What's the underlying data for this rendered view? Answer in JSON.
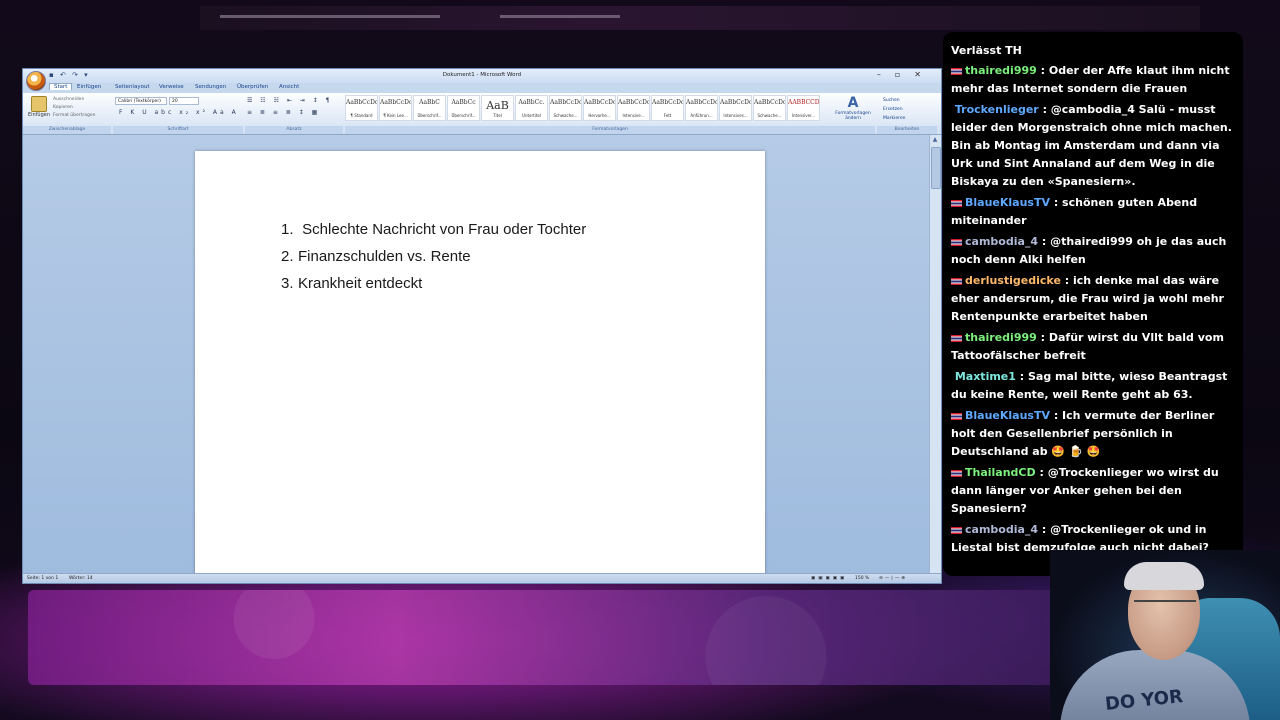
{
  "word": {
    "window_title": "Dokument1 - Microsoft Word",
    "tabs": [
      "Start",
      "Einfügen",
      "Seitenlayout",
      "Verweise",
      "Sendungen",
      "Überprüfen",
      "Ansicht"
    ],
    "ribbon": {
      "paste_label": "Einfügen",
      "cut_label": "Ausschneiden",
      "copy_label": "Kopieren",
      "format_painter_label": "Format übertragen",
      "font_name": "Calibri (Textkörper)",
      "font_size": "20",
      "group_clipboard": "Zwischenablage",
      "group_font": "Schriftart",
      "group_paragraph": "Absatz",
      "group_styles": "Formatvorlagen",
      "group_editing": "Bearbeiten",
      "change_styles_label": "Formatvorlagen ändern",
      "find_label": "Suchen",
      "replace_label": "Ersetzen",
      "select_label": "Markieren",
      "styles": [
        {
          "sample": "AaBbCcDc",
          "name": "¶ Standard"
        },
        {
          "sample": "AaBbCcDc",
          "name": "¶ Kein Lee..."
        },
        {
          "sample": "AaBbC",
          "name": "Überschrif..."
        },
        {
          "sample": "AaBbCc",
          "name": "Überschrif..."
        },
        {
          "sample": "AaB",
          "name": "Titel"
        },
        {
          "sample": "AaBbCc.",
          "name": "Untertitel"
        },
        {
          "sample": "AaBbCcDc",
          "name": "Schwache..."
        },
        {
          "sample": "AaBbCcDc",
          "name": "Hervorhe..."
        },
        {
          "sample": "AaBbCcDc",
          "name": "Intensive..."
        },
        {
          "sample": "AaBbCcDc",
          "name": "Fett"
        },
        {
          "sample": "AaBbCcDc",
          "name": "Anführun..."
        },
        {
          "sample": "AaBbCcDc",
          "name": "Intensives..."
        },
        {
          "sample": "AaBbCcDc",
          "name": "Schwache..."
        },
        {
          "sample": "AABBCCDC",
          "name": "Intensiver..."
        }
      ]
    },
    "document_lines": [
      {
        "num": "1.",
        "text": " Schlechte Nachricht von Frau oder Tochter"
      },
      {
        "num": "2.",
        "text": "Finanzschulden vs. Rente"
      },
      {
        "num": "3.",
        "text": "Krankheit entdeckt"
      }
    ],
    "status": {
      "page": "Seite: 1 von 1",
      "words": "Wörter: 14",
      "zoom": "150 %"
    }
  },
  "chat": {
    "header": "Verlässt TH",
    "messages": [
      {
        "user": "thairedi999",
        "color": "#7cf07c",
        "flag": true,
        "text": ": Oder der Affe klaut ihm nicht mehr das Internet sondern die Frauen"
      },
      {
        "user": "Trockenlieger",
        "color": "#5fa8ff",
        "flag": false,
        "text": ": @cambodia_4 Salü - musst leider den Morgenstraich ohne mich machen. Bin ab Montag im Amsterdam und dann via Urk und Sint Annaland auf dem Weg in die Biskaya zu den «Spanesiern»."
      },
      {
        "user": "BlaueKlausTV",
        "color": "#5fa8ff",
        "flag": true,
        "text": ": schönen guten Abend miteinander"
      },
      {
        "user": "cambodia_4",
        "color": "#b0b8d8",
        "flag": true,
        "text": ": @thairedi999 oh je das auch noch denn Alki helfen"
      },
      {
        "user": "derlustigedicke",
        "color": "#ffb86b",
        "flag": true,
        "text": ": ich denke mal das wäre eher andersrum, die Frau wird ja wohl mehr Rentenpunkte erarbeitet haben"
      },
      {
        "user": "thairedi999",
        "color": "#7cf07c",
        "flag": true,
        "text": ": Dafür wirst du Vllt bald vom Tattoofälscher befreit"
      },
      {
        "user": "Maxtime1",
        "color": "#7ee8e0",
        "flag": false,
        "text": ": Sag mal bitte, wieso Beantragst du keine Rente, weil Rente geht ab 63."
      },
      {
        "user": "BlaueKlausTV",
        "color": "#5fa8ff",
        "flag": true,
        "text": ": Ich vermute der Berliner holt den Gesellenbrief persönlich in Deutschland ab 🤩 🍺 🤩"
      },
      {
        "user": "ThailandCD",
        "color": "#7cf07c",
        "flag": true,
        "text": ": @Trockenlieger wo wirst du dann länger vor Anker gehen bei den Spanesiern?"
      },
      {
        "user": "cambodia_4",
        "color": "#b0b8d8",
        "flag": true,
        "text": ": @Trockenlieger ok und in Liestal bist demzufolge auch nicht dabei?"
      }
    ]
  },
  "webcam": {
    "shirt_text": "DO YOR"
  }
}
